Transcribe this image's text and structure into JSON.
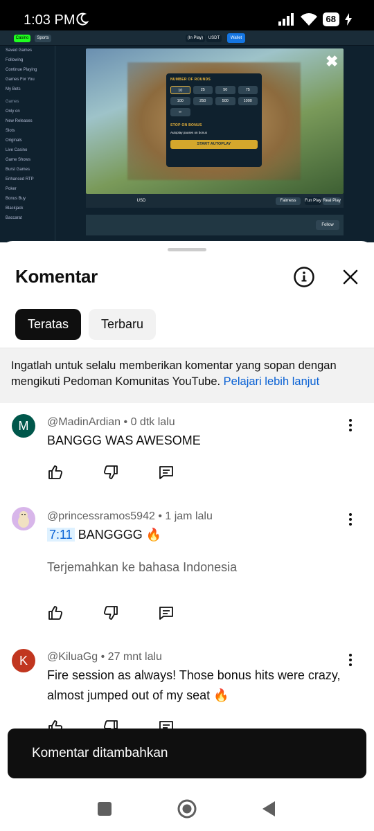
{
  "status_bar": {
    "time": "1:03 PM",
    "battery": "68"
  },
  "video": {
    "nav": {
      "casino": "Casino",
      "sports": "Sports",
      "in_play": "(In Play)",
      "currency": "USDT",
      "wallet": "Wallet"
    },
    "sidebar": [
      "Saved Games",
      "Following",
      "Continue Playing",
      "Games For You",
      "My Bets",
      "Games",
      "Only on",
      "New Releases",
      "Slots",
      "Originals",
      "Live Casino",
      "Game Shows",
      "Burst Games",
      "Enhanced RTP",
      "Poker",
      "Bonus Buy",
      "Blackjack",
      "Baccarat"
    ],
    "modal": {
      "rounds_label": "NUMBER OF ROUNDS",
      "rounds": [
        "10",
        "25",
        "50",
        "75",
        "100",
        "250",
        "500",
        "1000",
        "∞"
      ],
      "stop_label": "STOP ON BONUS",
      "toggle_label": "Autoplay pauses on bonus",
      "start": "START AUTOPLAY"
    },
    "bar": {
      "currency": "USD",
      "fairness": "Fairness",
      "fun_play": "Fun Play",
      "real_play": "Real Play"
    },
    "info": {
      "follow": "Follow"
    }
  },
  "sheet": {
    "title": "Komentar",
    "tabs": [
      {
        "label": "Teratas",
        "active": true
      },
      {
        "label": "Terbaru",
        "active": false
      }
    ],
    "notice": {
      "text": "Ingatlah untuk selalu memberikan komentar yang sopan dengan mengikuti Pedoman Komunitas YouTube. ",
      "link": "Pelajari lebih lanjut"
    },
    "comments": [
      {
        "initial": "M",
        "author": "@MadinArdian",
        "time": " • 0 dtk lalu",
        "text": "BANGGG WAS AWESOME",
        "color": "#00574b"
      },
      {
        "initial": "",
        "author": "@princessramos5942",
        "time": " • 1 jam lalu",
        "timestamp": "7:11",
        "text": " BANGGGG 🔥",
        "translate": "Terjemahkan ke bahasa Indonesia",
        "color": "#c9a0dc"
      },
      {
        "initial": "K",
        "author": "@KiluaGg",
        "time": " • 27 mnt lalu",
        "text": "Fire session as always! Those bonus hits were crazy, almost jumped out of my seat 🔥",
        "color": "#c1361f"
      }
    ]
  },
  "toast": "Komentar ditambahkan"
}
